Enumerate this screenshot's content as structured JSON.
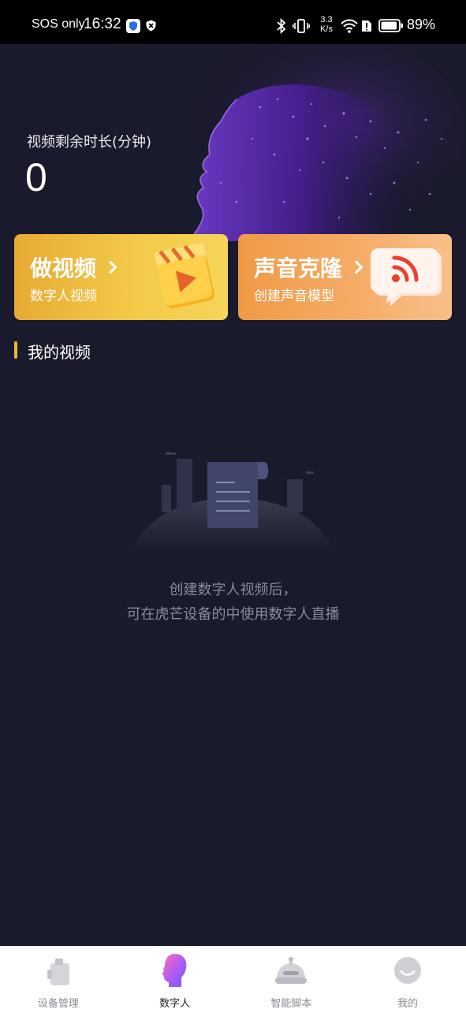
{
  "status_bar": {
    "carrier": "SOS only",
    "time": "16:32",
    "net_speed_value": "3.3",
    "net_speed_unit": "K/s",
    "battery": "89%"
  },
  "hero": {
    "label": "视频剩余时长(分钟)",
    "value": "0"
  },
  "cards": [
    {
      "title": "做视频",
      "subtitle": "数字人视频",
      "icon": "video-clapper-icon"
    },
    {
      "title": "声音克隆",
      "subtitle": "创建声音模型",
      "icon": "voice-bubble-icon"
    }
  ],
  "section": {
    "title": "我的视频"
  },
  "empty_state": {
    "line1": "创建数字人视频后，",
    "line2": "可在虎芒设备的中使用数字人直播",
    "icon": "empty-document-icon"
  },
  "bottom_nav": {
    "items": [
      {
        "label": "设备管理",
        "icon": "device-icon"
      },
      {
        "label": "数字人",
        "icon": "digital-human-icon",
        "active": true
      },
      {
        "label": "智能脚本",
        "icon": "robot-icon"
      },
      {
        "label": "我的",
        "icon": "profile-icon"
      }
    ]
  },
  "colors": {
    "background": "#191a2b",
    "accent": "#f0b73a",
    "video_card": "#f3c948",
    "voice_card": "#f5ac66"
  }
}
